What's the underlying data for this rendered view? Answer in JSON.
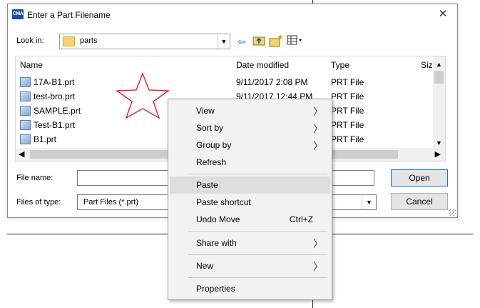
{
  "dialog": {
    "app_icon_text": "CMA",
    "title": "Enter a Part Filename",
    "close_symbol": "✕",
    "look_in_label": "Look in:",
    "look_in_value": "parts",
    "columns": {
      "name": "Name",
      "date": "Date modified",
      "type": "Type",
      "size": "Size"
    },
    "files": [
      {
        "name": "17A-B1.prt",
        "date": "9/11/2017 2:08 PM",
        "type": "PRT File"
      },
      {
        "name": "test-bro.prt",
        "date": "9/11/2017 12:44 PM",
        "type": "PRT File"
      },
      {
        "name": "SAMPLE.prt",
        "date": "",
        "type": "PRT File"
      },
      {
        "name": "Test-B1.prt",
        "date": "",
        "type": "PRT File"
      },
      {
        "name": "B1.prt",
        "date": "",
        "type": "PRT File"
      }
    ],
    "file_name_label": "File name:",
    "file_name_value": "",
    "file_type_label": "Files of type:",
    "file_type_value": "Part Files (*.prt)",
    "open_label": "Open",
    "cancel_label": "Cancel"
  },
  "context_menu": {
    "items": [
      {
        "label": "View",
        "submenu": true
      },
      {
        "label": "Sort by",
        "submenu": true
      },
      {
        "label": "Group by",
        "submenu": true
      },
      {
        "label": "Refresh"
      },
      {
        "label": "Paste",
        "highlighted": true
      },
      {
        "label": "Paste shortcut"
      },
      {
        "label": "Undo Move",
        "shortcut": "Ctrl+Z"
      },
      {
        "label": "Share with",
        "submenu": true
      },
      {
        "label": "New",
        "submenu": true
      },
      {
        "label": "Properties"
      }
    ]
  },
  "colors": {
    "highlight": "#dedede",
    "menu_background": "#f2f2f2",
    "star_outline": "#e02020",
    "open_button_border": "#0078d7"
  },
  "icons": {
    "back": "back-arrow-icon",
    "up": "up-folder-icon",
    "new_folder": "new-folder-icon",
    "view_menu": "view-menu-icon",
    "star": "star-outline-icon"
  }
}
